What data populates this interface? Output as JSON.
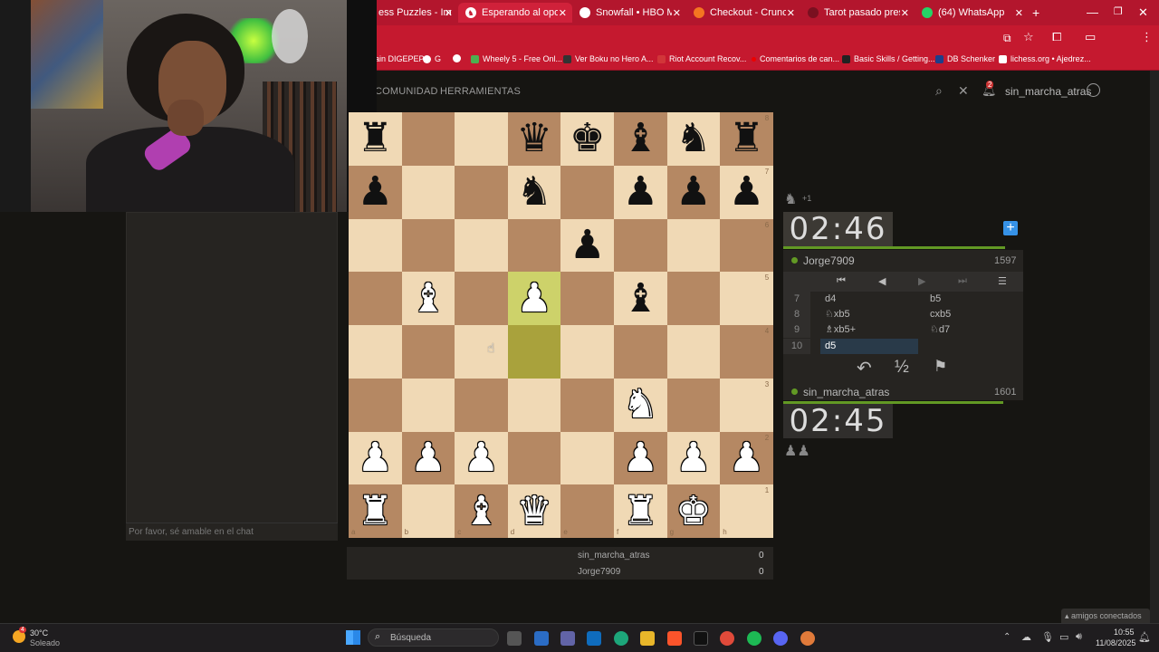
{
  "browser": {
    "tabs": [
      {
        "label": "ess Puzzles - Improve",
        "active": false
      },
      {
        "label": "Esperando al oponente",
        "active": true
      },
      {
        "label": "Snowfall • HBO Max",
        "active": false
      },
      {
        "label": "Checkout - Crunchyroll",
        "active": false
      },
      {
        "label": "Tarot pasado presente",
        "active": false
      },
      {
        "label": "(64) WhatsApp",
        "active": false
      }
    ],
    "new_tab": "+",
    "bookmarks": [
      "ain DIGEPEP",
      "G",
      "Wheely 5 - Free Onl...",
      "Ver Boku no Hero A...",
      "Riot Account Recov...",
      "Comentarios de can...",
      "Basic Skills / Getting...",
      "DB Schenker",
      "lichess.org • Ajedrez..."
    ]
  },
  "site": {
    "nav": [
      "COMUNIDAD",
      "HERRAMIENTAS"
    ],
    "username": "sin_marcha_atras",
    "notif_count": "2"
  },
  "chat": {
    "placeholder": "Por favor, sé amable en el chat"
  },
  "board": {
    "files": [
      "a",
      "b",
      "c",
      "d",
      "e",
      "f",
      "g",
      "h"
    ],
    "ranks": [
      "8",
      "7",
      "6",
      "5",
      "4",
      "3",
      "2",
      "1"
    ]
  },
  "opponent": {
    "name": "Jorge7909",
    "rating": "1597",
    "clock": "02:46",
    "plus": "+1"
  },
  "player": {
    "name": "sin_marcha_atras",
    "rating": "1601",
    "clock": "02:45"
  },
  "moves": [
    {
      "num": "7",
      "white": "d4",
      "black": "b5"
    },
    {
      "num": "8",
      "white": "♘xb5",
      "black": "cxb5"
    },
    {
      "num": "9",
      "white": "♗xb5+",
      "black": "♘d7"
    },
    {
      "num": "10",
      "white": "d5",
      "black": ""
    }
  ],
  "controls": {
    "takeback": "↶",
    "draw": "½",
    "resign": "⚑"
  },
  "crosstable": [
    {
      "name": "sin_marcha_atras",
      "score": "0"
    },
    {
      "name": "Jorge7909",
      "score": "0"
    }
  ],
  "friends": "amigos conectados",
  "taskbar": {
    "weather_temp": "30°C",
    "weather_desc": "Soleado",
    "search": "Búsqueda",
    "time": "10:55",
    "date": "11/08/2025",
    "weather_badge": "4"
  },
  "colors": {
    "accent_green": "#629924",
    "browser_red": "#c5192f"
  }
}
